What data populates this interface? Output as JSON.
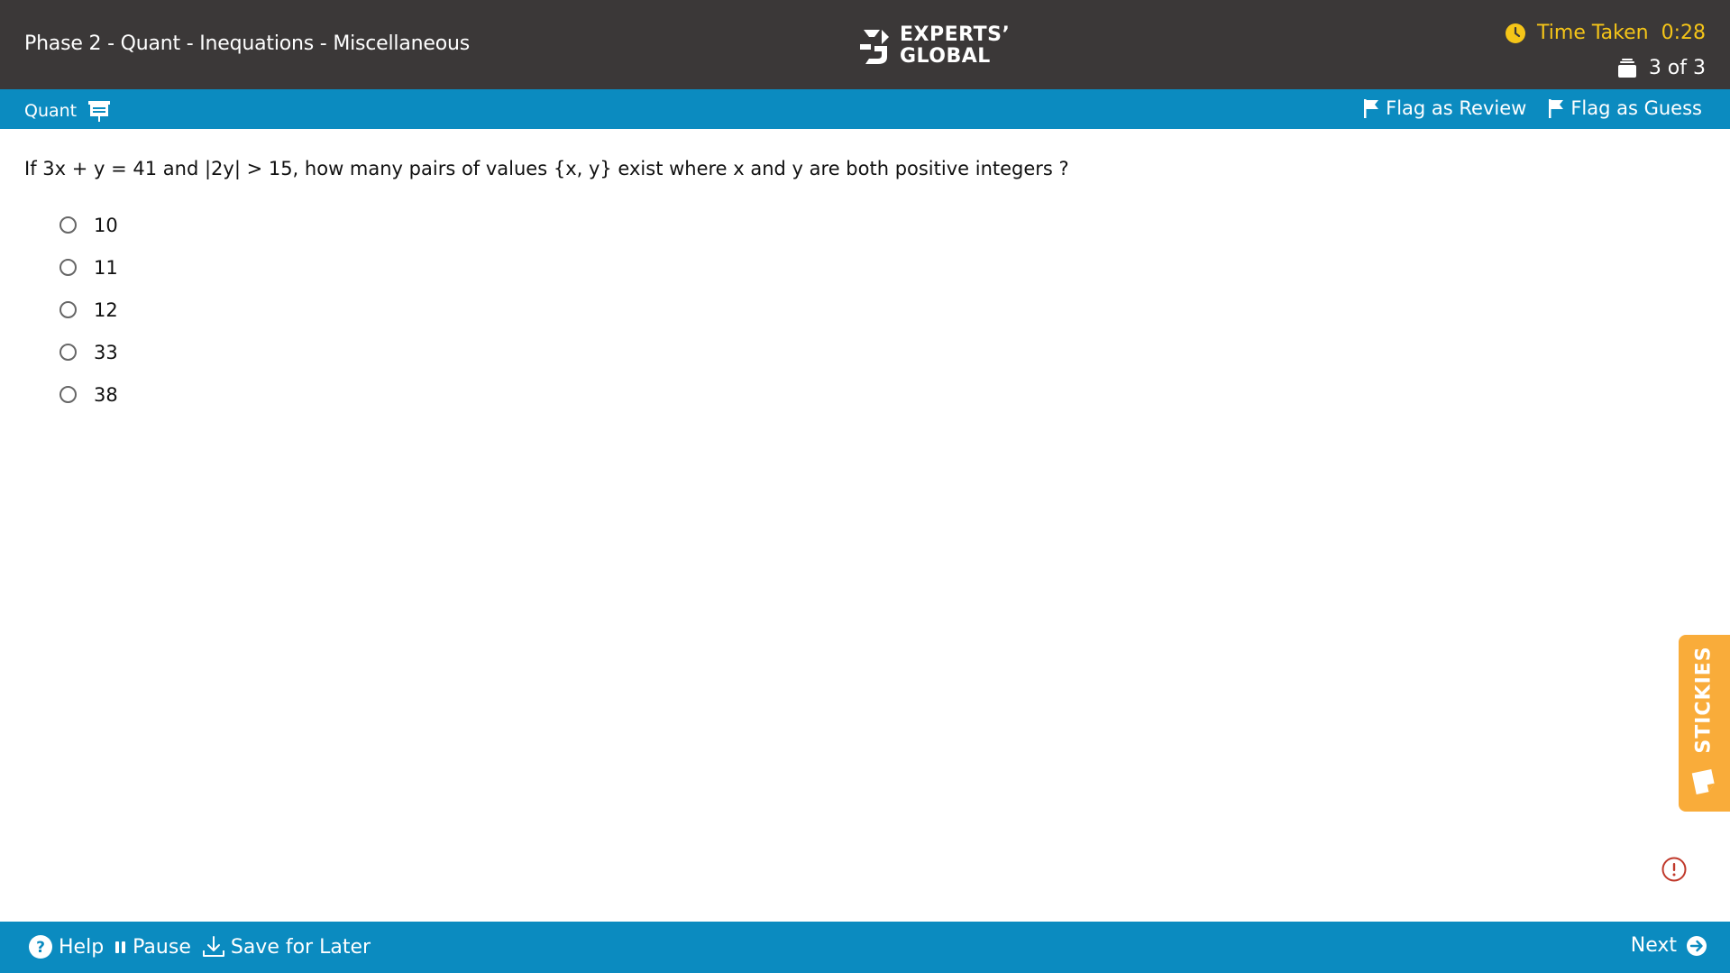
{
  "header": {
    "title": "Phase 2 - Quant - Inequations - Miscellaneous",
    "logo_line1": "EXPERTS’",
    "logo_line2": "GLOBAL",
    "time_label": "Time Taken",
    "time_value": "0:28",
    "counter": "3 of 3",
    "colors": {
      "header_bg": "#3b3838",
      "timer": "#f5c518"
    }
  },
  "subbar": {
    "section": "Quant",
    "flag_review": "Flag as Review",
    "flag_guess": "Flag as Guess",
    "color": "#0b8bc0"
  },
  "question": {
    "text": "If 3x + y = 41 and |2y| > 15, how many pairs of values {x, y} exist where x and y are both positive integers ?",
    "options": [
      "10",
      "11",
      "12",
      "33",
      "38"
    ]
  },
  "stickies": {
    "label": "STICKIES",
    "color": "#f9ac3a"
  },
  "footer": {
    "help": "Help",
    "pause": "Pause",
    "save": "Save for Later",
    "next": "Next"
  },
  "icons": [
    "logo-icon",
    "clock-icon",
    "stack-icon",
    "presentation-icon",
    "flag-icon",
    "sticky-note-icon",
    "alert-icon",
    "help-icon",
    "pause-icon",
    "download-icon",
    "arrow-right-icon"
  ]
}
